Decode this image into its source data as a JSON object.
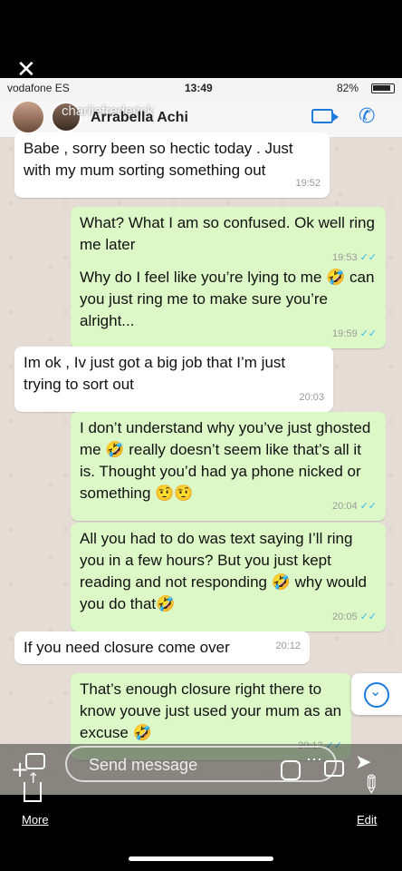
{
  "story": {
    "more_label": "More",
    "edit_label": "Edit"
  },
  "statusbar": {
    "carrier": "vodafone ES",
    "time": "13:49",
    "battery": "82%"
  },
  "header": {
    "overlay_user": "charliefrederick",
    "contact_name": "Arrabella Achi"
  },
  "messages": [
    {
      "dir": "in",
      "text": "Babe , sorry been so hectic today . Just with my mum sorting something out",
      "time": "19:52"
    },
    {
      "dir": "out",
      "text": "What? What I am so confused. Ok well ring me later",
      "time": "19:53"
    },
    {
      "dir": "out",
      "text": "Why do I feel like you’re lying to me 🤣 can you just ring me to make sure you’re alright...",
      "time": "19:59"
    },
    {
      "dir": "in",
      "text": "Im ok , Iv just got a big job that I’m just trying to sort out",
      "time": "20:03"
    },
    {
      "dir": "out",
      "text": "I don’t understand why you’ve just ghosted me 🤣 really doesn’t seem like that’s all it is. Thought you’d had ya phone nicked or something 🤨🤨",
      "time": "20:04"
    },
    {
      "dir": "out",
      "text": "All you had to do was text saying I’ll ring you in a few hours? But you just kept reading and not responding 🤣 why would you do that🤣",
      "time": "20:05"
    },
    {
      "dir": "in",
      "text": "If you need closure come over",
      "time": "20:12"
    },
    {
      "dir": "out",
      "text": "That’s enough closure right there to know youve just used your mum as an excuse 🤣",
      "time": "20:12"
    }
  ],
  "composer": {
    "placeholder": "Send message"
  },
  "icons": {
    "close": "close-icon",
    "video": "video-call-icon",
    "call": "phone-call-icon",
    "camera": "camera-icon",
    "sticker": "sticker-icon",
    "send": "send-icon",
    "share": "share-icon",
    "pencil": "pencil-icon",
    "scroll": "chevron-down-icon"
  },
  "colors": {
    "incoming_bubble": "#ffffff",
    "outgoing_bubble": "#dcf8c6",
    "chat_background": "#e5ddd5",
    "read_ticks": "#34b7f1",
    "accent": "#1f7ae0"
  }
}
